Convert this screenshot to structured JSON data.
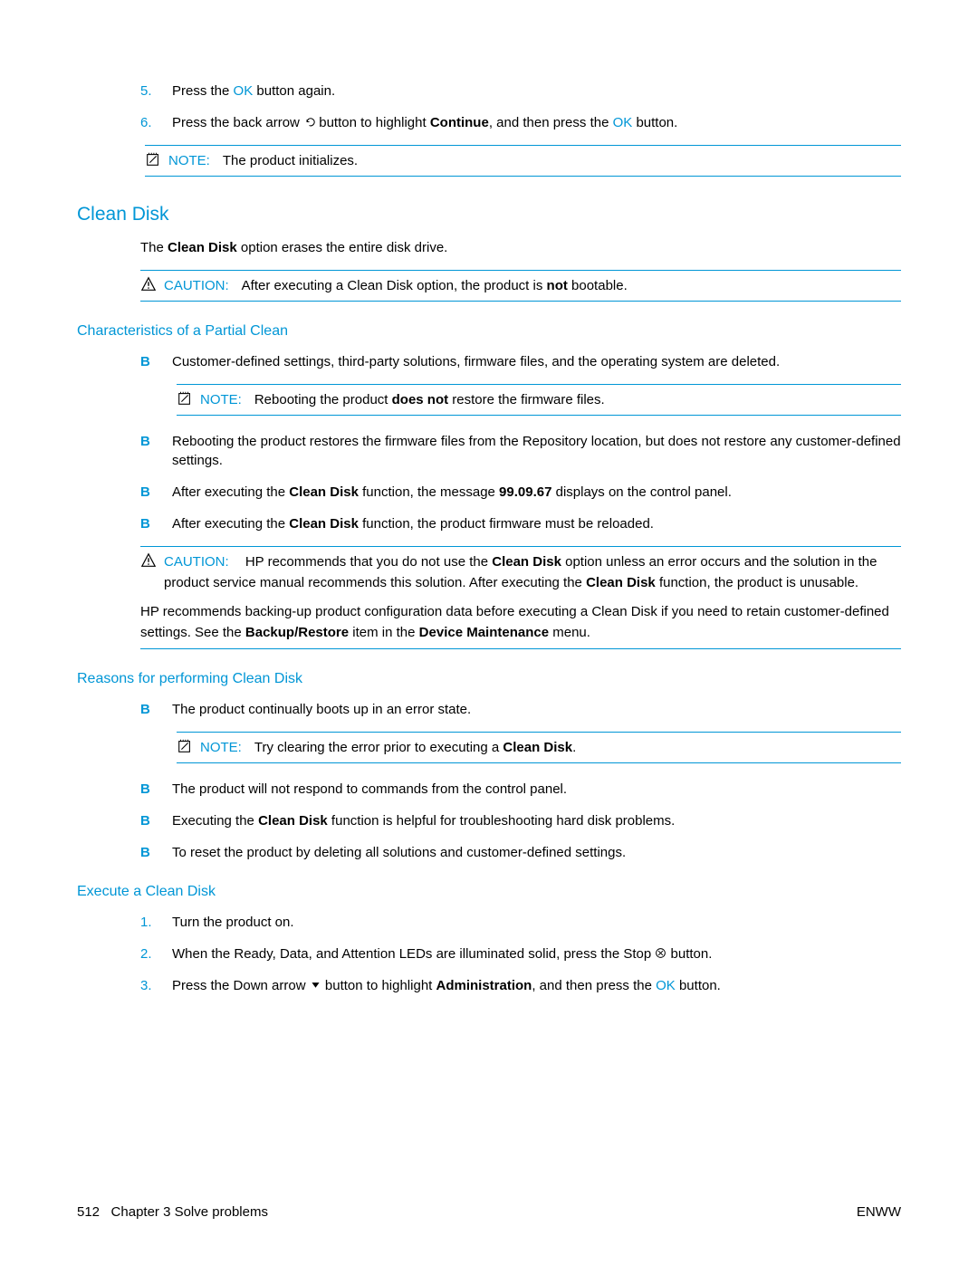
{
  "steps_top": {
    "s5_num": "5.",
    "s5": "Press the ",
    "s5_ok": "OK",
    "s5_end": " button again.",
    "s6_num": "6.",
    "s6_a": "Press the back arrow ",
    "s6_b": " button to highlight ",
    "s6_bold": "Continue",
    "s6_c": ", and then press the ",
    "s6_ok": "OK",
    "s6_d": " button."
  },
  "note1": {
    "label": "NOTE:",
    "text": "The product initializes."
  },
  "h_clean": "Clean Disk",
  "cd_intro_a": "The ",
  "cd_intro_b": "Clean Disk",
  "cd_intro_c": " option erases the entire disk drive.",
  "caution1": {
    "label": "CAUTION:",
    "a": "After executing a Clean Disk option, the product is ",
    "b": "not",
    "c": " bootable."
  },
  "h_char": "Characteristics of a Partial Clean",
  "char1": "Customer-defined settings, third-party solutions, firmware files, and the operating system are deleted.",
  "note2": {
    "label": "NOTE:",
    "a": "Rebooting the product ",
    "b": "does not",
    "c": " restore the firmware files."
  },
  "char2": "Rebooting the product restores the firmware files from the Repository location, but does not restore any customer-defined settings.",
  "char3_a": "After executing the ",
  "char3_b": "Clean Disk",
  "char3_c": " function, the message ",
  "char3_d": "99.09.67",
  "char3_e": " displays on the control panel.",
  "char4_a": "After executing the ",
  "char4_b": "Clean Disk",
  "char4_c": " function, the product firmware must be reloaded.",
  "caution2": {
    "label": "CAUTION:",
    "line1_a": "HP recommends that you do not use the ",
    "line1_b": "Clean Disk",
    "line1_c": " option unless an error occurs and the solution in the product service manual recommends this solution. After executing the ",
    "line1_d": "Clean Disk",
    "line1_e": " function, the product is unusable.",
    "p2_a": "HP recommends backing-up product configuration data before executing a Clean Disk if you need to retain customer-defined settings. See the ",
    "p2_b": "Backup/Restore",
    "p2_c": " item in the ",
    "p2_d": "Device Maintenance",
    "p2_e": " menu."
  },
  "h_reasons": "Reasons for performing Clean Disk",
  "r1": "The product continually boots up in an error state.",
  "note3": {
    "label": "NOTE:",
    "a": "Try clearing the error prior to executing a ",
    "b": "Clean Disk",
    "c": "."
  },
  "r2": "The product will not respond to commands from the control panel.",
  "r3_a": "Executing the ",
  "r3_b": "Clean Disk",
  "r3_c": " function is helpful for troubleshooting hard disk problems.",
  "r4": "To reset the product by deleting all solutions and customer-defined settings.",
  "h_exec": "Execute a Clean Disk",
  "e1_num": "1.",
  "e1": "Turn the product on.",
  "e2_num": "2.",
  "e2_a": "When the Ready, Data, and Attention LEDs are illuminated solid, press the Stop ",
  "e2_b": " button.",
  "e3_num": "3.",
  "e3_a": "Press the Down arrow ",
  "e3_b": " button to highlight ",
  "e3_bold": "Administration",
  "e3_c": ", and then press the ",
  "e3_ok": "OK",
  "e3_d": " button.",
  "footer": {
    "page": "512",
    "chapter": "Chapter 3   Solve problems",
    "right": "ENWW"
  }
}
